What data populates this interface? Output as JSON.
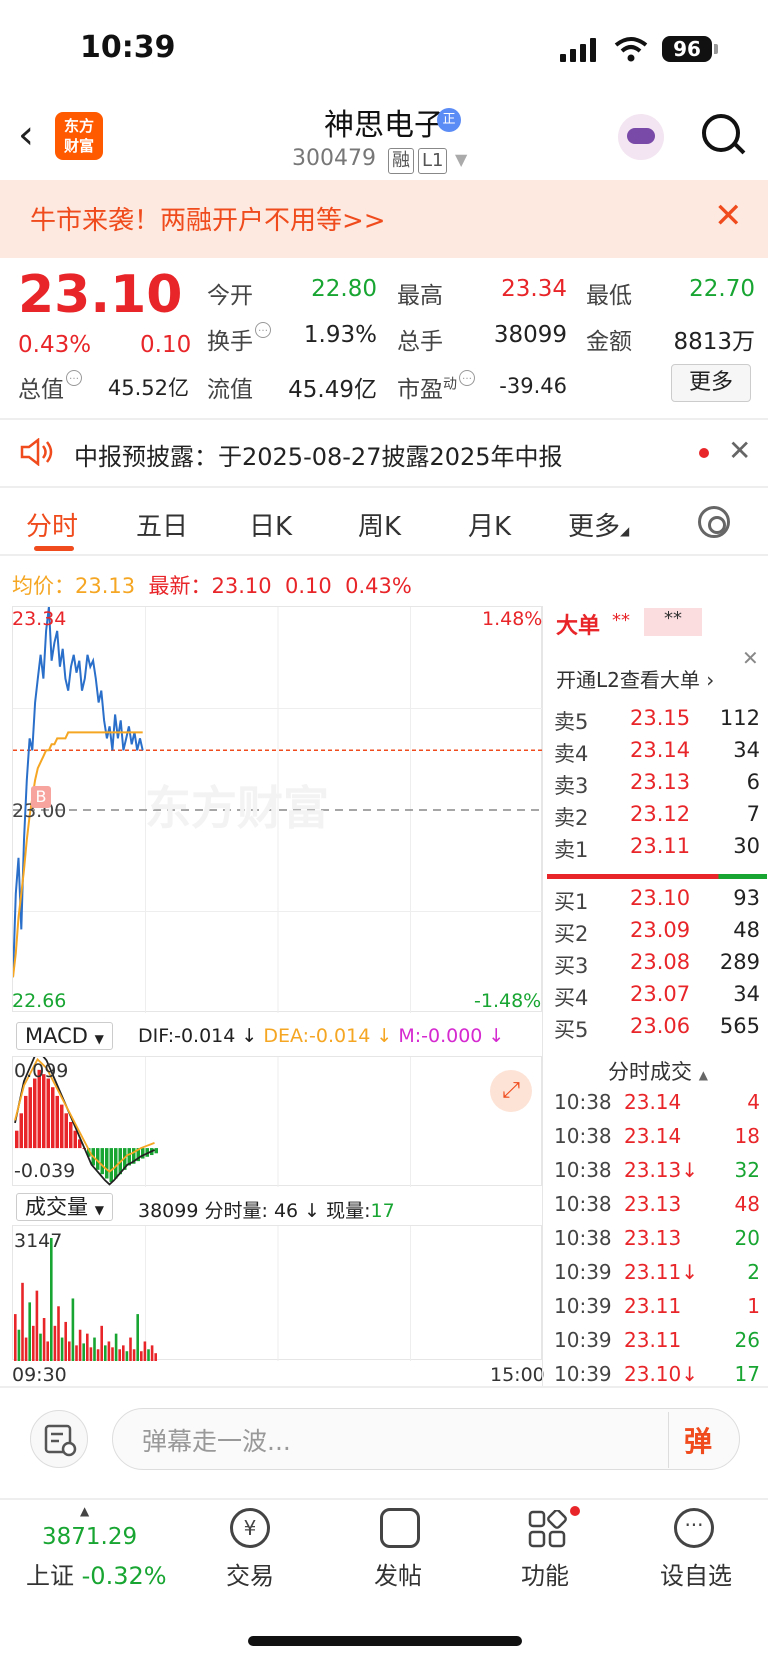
{
  "status": {
    "time": "10:39",
    "battery": "96"
  },
  "header": {
    "logo": "东方财富",
    "stock_name": "神思电子",
    "stock_code": "300479",
    "tags": [
      "融",
      "L1"
    ],
    "badge": "正"
  },
  "banner": {
    "text": "牛市来袭！两融开户不用等>>"
  },
  "quote": {
    "price": "23.10",
    "change_pct": "0.43%",
    "change": "0.10",
    "fields": [
      {
        "label": "今开",
        "value": "22.80",
        "color": "green"
      },
      {
        "label": "最高",
        "value": "23.34",
        "color": "red"
      },
      {
        "label": "最低",
        "value": "22.70",
        "color": "green"
      },
      {
        "label": "换手",
        "value": "1.93%",
        "color": "black"
      },
      {
        "label": "总手",
        "value": "38099",
        "color": "black"
      },
      {
        "label": "金额",
        "value": "8813万",
        "color": "black"
      },
      {
        "label": "总值",
        "value": "45.52亿",
        "color": "black"
      },
      {
        "label": "流值",
        "value": "45.49亿",
        "color": "black"
      },
      {
        "label": "市盈",
        "sup": "动",
        "value": "-39.46",
        "color": "black"
      }
    ],
    "more_label": "更多"
  },
  "notice": {
    "text": "中报预披露：于2025-08-27披露2025年中报"
  },
  "tabs": [
    "分时",
    "五日",
    "日K",
    "周K",
    "月K",
    "更多"
  ],
  "avg_line": {
    "avg_label": "均价：",
    "avg_value": "23.13",
    "last_label": "最新：",
    "last_value": "23.10",
    "change": "0.10",
    "pct": "0.43%"
  },
  "chart_data": [
    {
      "type": "line",
      "title": "",
      "y_labels": {
        "top": "23.34",
        "mid": "23.00",
        "bottom": "22.66",
        "top_pct": "1.48%",
        "bottom_pct": "-1.48%"
      },
      "ylim": [
        22.66,
        23.34
      ],
      "prev_close": 23.0,
      "x_labels": [
        "09:30",
        "15:00"
      ],
      "series": [
        {
          "name": "price",
          "color": "#2a6fc9",
          "values": [
            22.72,
            22.86,
            22.92,
            22.8,
            22.95,
            23.05,
            23.12,
            23.1,
            23.18,
            23.22,
            23.26,
            23.22,
            23.3,
            23.34,
            23.25,
            23.28,
            23.3,
            23.24,
            23.27,
            23.22,
            23.2,
            23.24,
            23.26,
            23.23,
            23.25,
            23.2,
            23.22,
            23.26,
            23.24,
            23.25,
            23.22,
            23.18,
            23.2,
            23.15,
            23.12,
            23.14,
            23.1,
            23.16,
            23.12,
            23.15,
            23.1,
            23.12,
            23.14,
            23.11,
            23.13,
            23.1,
            23.12,
            23.1
          ]
        },
        {
          "name": "avg",
          "color": "#f5a623",
          "values": [
            22.72,
            22.76,
            22.82,
            22.86,
            22.9,
            22.95,
            22.99,
            23.02,
            23.05,
            23.07,
            23.08,
            23.09,
            23.1,
            23.1,
            23.11,
            23.11,
            23.12,
            23.12,
            23.12,
            23.12,
            23.13,
            23.13,
            23.13,
            23.13,
            23.13,
            23.13,
            23.13,
            23.13,
            23.13,
            23.13,
            23.13,
            23.13,
            23.13,
            23.13,
            23.13,
            23.13,
            23.13,
            23.13,
            23.13,
            23.13,
            23.13,
            23.13,
            23.13,
            23.13,
            23.13,
            23.13,
            23.13,
            23.13
          ]
        }
      ]
    },
    {
      "type": "bar",
      "title": "MACD",
      "dif": "DIF:-0.014 ↓",
      "dea": "DEA:-0.014 ↓",
      "m": "M:-0.000 ↓",
      "y_labels": {
        "top": "0.099",
        "bottom": "-0.039"
      },
      "values": [
        0.02,
        0.04,
        0.06,
        0.07,
        0.08,
        0.09,
        0.085,
        0.08,
        0.07,
        0.06,
        0.05,
        0.04,
        0.03,
        0.02,
        0.01,
        0.0,
        -0.01,
        -0.02,
        -0.025,
        -0.03,
        -0.035,
        -0.039,
        -0.035,
        -0.03,
        -0.025,
        -0.02,
        -0.018,
        -0.015,
        -0.012,
        -0.01,
        -0.008,
        -0.006
      ]
    },
    {
      "type": "bar",
      "title": "成交量",
      "summary": "38099",
      "interval_label": "分时量: 46 ↓",
      "now_label": "现量:",
      "now_value": "17",
      "y_labels": {
        "top": "3147"
      },
      "values": [
        1200,
        800,
        2000,
        600,
        1500,
        900,
        1800,
        700,
        1100,
        500,
        3147,
        900,
        1400,
        600,
        1000,
        500,
        1600,
        400,
        800,
        450,
        700,
        350,
        600,
        300,
        900,
        400,
        500,
        350,
        700,
        300,
        400,
        250,
        600,
        300,
        1200,
        250,
        500,
        300,
        400,
        200
      ]
    }
  ],
  "macd_selector": "MACD",
  "vol_selector": "成交量",
  "order_book": {
    "big_label": "大单",
    "big_mask1": "**",
    "big_mask2": "**",
    "l2_text": "开通L2查看大单 ›",
    "asks": [
      {
        "label": "卖5",
        "price": "23.15",
        "vol": "112"
      },
      {
        "label": "卖4",
        "price": "23.14",
        "vol": "34"
      },
      {
        "label": "卖3",
        "price": "23.13",
        "vol": "6"
      },
      {
        "label": "卖2",
        "price": "23.12",
        "vol": "7"
      },
      {
        "label": "卖1",
        "price": "23.11",
        "vol": "30"
      }
    ],
    "bids": [
      {
        "label": "买1",
        "price": "23.10",
        "vol": "93"
      },
      {
        "label": "买2",
        "price": "23.09",
        "vol": "48"
      },
      {
        "label": "买3",
        "price": "23.08",
        "vol": "289"
      },
      {
        "label": "买4",
        "price": "23.07",
        "vol": "34"
      },
      {
        "label": "买5",
        "price": "23.06",
        "vol": "565"
      }
    ],
    "ticks_title": "分时成交",
    "ticks": [
      {
        "time": "10:38",
        "price": "23.14",
        "vol": "4",
        "vol_color": "red"
      },
      {
        "time": "10:38",
        "price": "23.14",
        "vol": "18",
        "vol_color": "red"
      },
      {
        "time": "10:38",
        "price": "23.13↓",
        "vol": "32",
        "vol_color": "green"
      },
      {
        "time": "10:38",
        "price": "23.13",
        "vol": "48",
        "vol_color": "red"
      },
      {
        "time": "10:38",
        "price": "23.13",
        "vol": "20",
        "vol_color": "green"
      },
      {
        "time": "10:39",
        "price": "23.11↓",
        "vol": "2",
        "vol_color": "green"
      },
      {
        "time": "10:39",
        "price": "23.11",
        "vol": "1",
        "vol_color": "red"
      },
      {
        "time": "10:39",
        "price": "23.11",
        "vol": "26",
        "vol_color": "green"
      },
      {
        "time": "10:39",
        "price": "23.10↓",
        "vol": "17",
        "vol_color": "green"
      }
    ]
  },
  "comment": {
    "placeholder": "弹幕走一波...",
    "dan": "弹"
  },
  "bottom_nav": {
    "index_value": "3871.29",
    "index_name": "上证",
    "index_pct": "-0.32%",
    "items": [
      "交易",
      "发帖",
      "功能",
      "设自选"
    ]
  },
  "watermark": "东方财富"
}
